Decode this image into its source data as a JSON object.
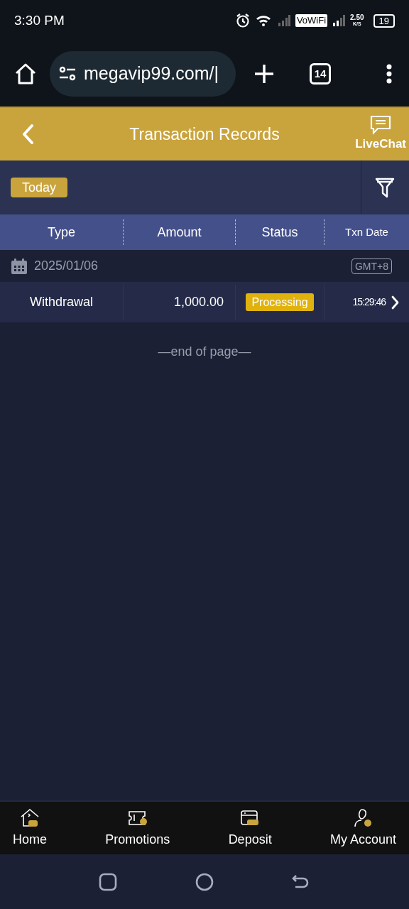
{
  "status_bar": {
    "time": "3:30 PM",
    "vowifi": "VoWiFi",
    "speed": "2.50",
    "speed_unit": "K/S",
    "battery": "19"
  },
  "browser": {
    "url": "megavip99.com/|",
    "tab_count": "14"
  },
  "header": {
    "title": "Transaction Records",
    "livechat": "LiveChat"
  },
  "filter": {
    "chip": "Today"
  },
  "table": {
    "columns": [
      "Type",
      "Amount",
      "Status",
      "Txn Date"
    ],
    "groups": [
      {
        "date": "2025/01/06",
        "timezone": "GMT+8",
        "rows": [
          {
            "type": "Withdrawal",
            "amount": "1,000.00",
            "status": "Processing",
            "time": "15:29:46"
          }
        ]
      }
    ]
  },
  "end_note": "—end of page—",
  "bottom_nav": [
    {
      "label": "Home",
      "kind": "home"
    },
    {
      "label": "Promotions",
      "kind": "ticket"
    },
    {
      "label": "Deposit",
      "kind": "card"
    },
    {
      "label": "My Account",
      "kind": "account"
    }
  ]
}
